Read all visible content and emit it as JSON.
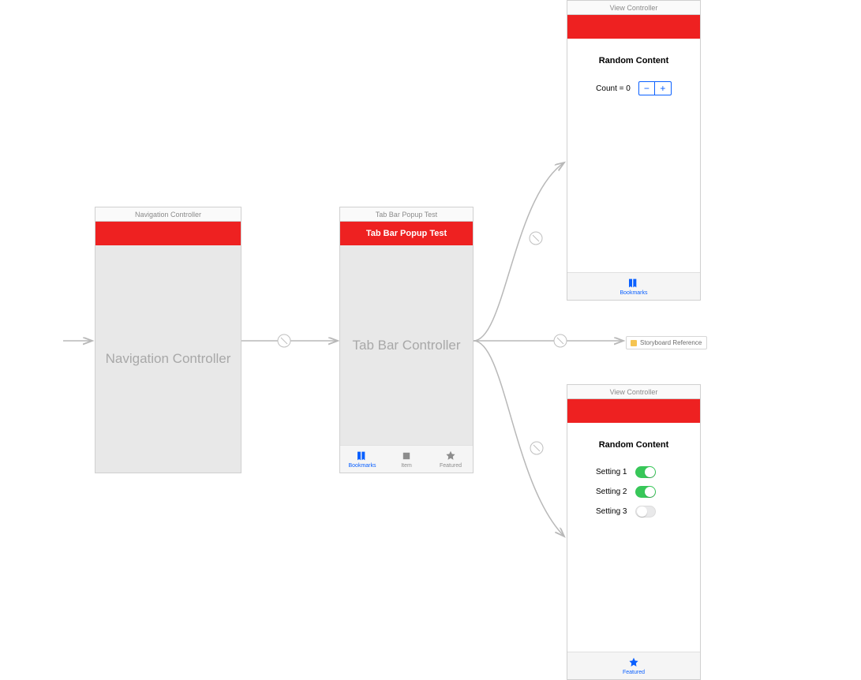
{
  "scenes": {
    "nav": {
      "title": "Navigation Controller",
      "placeholder": "Navigation Controller"
    },
    "tabbar": {
      "title": "Tab Bar Popup Test",
      "navTitle": "Tab Bar Popup Test",
      "placeholder": "Tab Bar Controller",
      "tabs": [
        {
          "label": "Bookmarks",
          "active": true
        },
        {
          "label": "Item",
          "active": false
        },
        {
          "label": "Featured",
          "active": false
        }
      ]
    },
    "vcTop": {
      "title": "View Controller",
      "heading": "Random Content",
      "countLabel": "Count = 0",
      "tabLabel": "Bookmarks"
    },
    "vcBottom": {
      "title": "View Controller",
      "heading": "Random Content",
      "settings": [
        {
          "label": "Setting 1",
          "on": true
        },
        {
          "label": "Setting 2",
          "on": true
        },
        {
          "label": "Setting 3",
          "on": false
        }
      ],
      "tabLabel": "Featured"
    },
    "sbRef": {
      "label": "Storyboard Reference"
    }
  }
}
